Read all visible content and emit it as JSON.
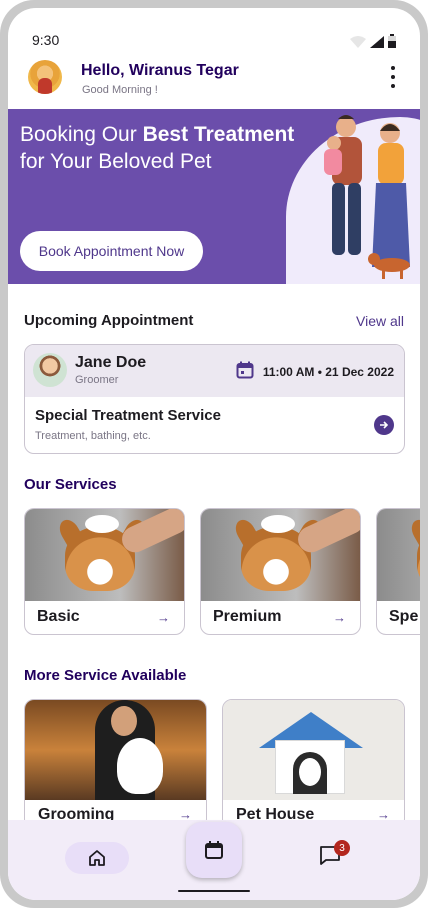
{
  "status_bar": {
    "time": "9:30"
  },
  "header": {
    "greeting": "Hello, Wiranus Tegar",
    "sub_greeting": "Good Morning !"
  },
  "banner": {
    "title_prefix": "Booking Our ",
    "title_bold": "Best Treatment",
    "title_suffix": "for Your Beloved Pet",
    "cta_label": "Book Appointment Now"
  },
  "upcoming": {
    "section_title": "Upcoming Appointment",
    "view_all": "View all",
    "appointment": {
      "name": "Jane Doe",
      "role": "Groomer",
      "datetime": "11:00 AM • 21 Dec 2022",
      "service": "Special Treatment Service",
      "description": "Treatment, bathing, etc."
    }
  },
  "services": {
    "section_title": "Our Services",
    "items": [
      {
        "label": "Basic"
      },
      {
        "label": "Premium"
      },
      {
        "label": "Spe"
      }
    ]
  },
  "more_services": {
    "section_title": "More Service Available",
    "items": [
      {
        "label": "Grooming"
      },
      {
        "label": "Pet House"
      }
    ]
  },
  "bottom_nav": {
    "chat_badge": "3"
  },
  "colors": {
    "primary": "#4f378b",
    "banner_bg": "#6b4eab",
    "heading_dark": "#21005d",
    "badge": "#b3261e",
    "nav_bg": "#f2ecf8"
  }
}
